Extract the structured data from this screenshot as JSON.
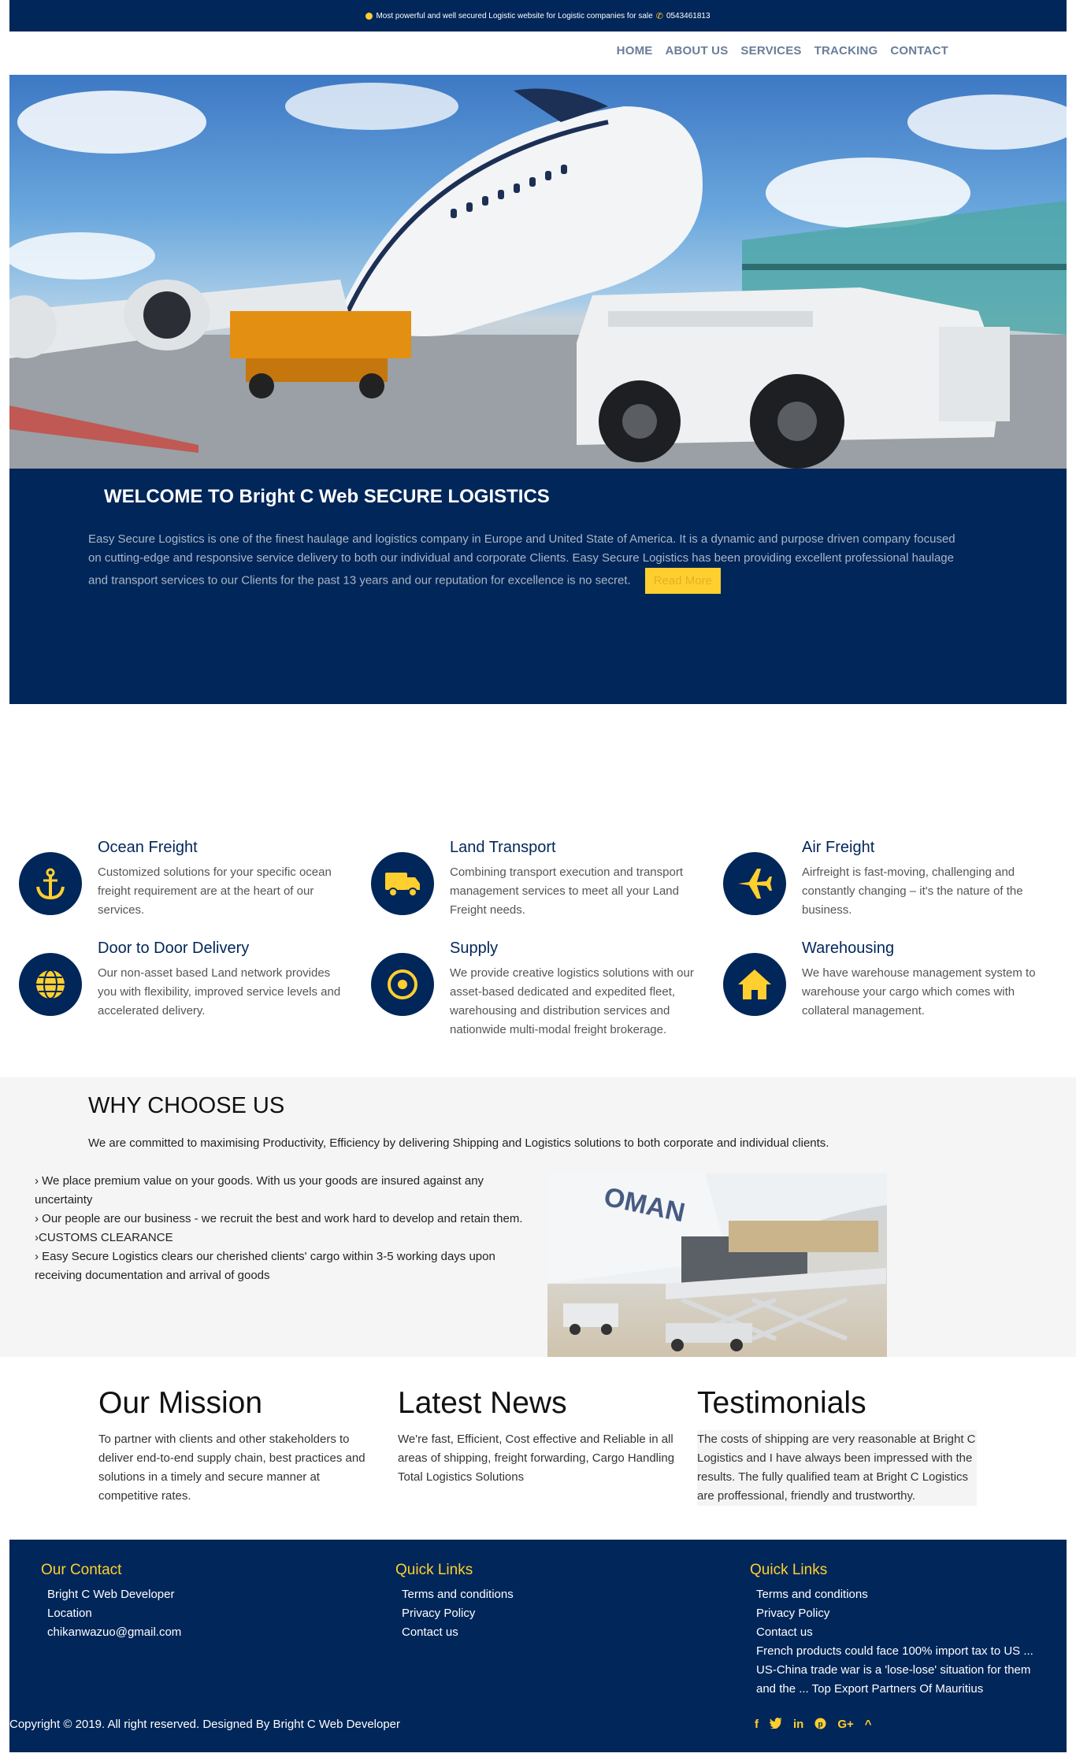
{
  "topbar": {
    "text": "Most powerful and well secured Logistic website for Logistic companies for sale",
    "phone": "0543461813"
  },
  "nav": {
    "items": [
      "HOME",
      "ABOUT US",
      "SERVICES",
      "TRACKING",
      "CONTACT"
    ]
  },
  "welcome": {
    "title": "WELCOME TO Bright C Web SECURE LOGISTICS",
    "body": "Easy Secure Logistics is one of the finest haulage and logistics company in Europe and United State of America. It is a dynamic and purpose driven company focused on cutting-edge and responsive service delivery to both our individual and corporate Clients. Easy Secure Logistics has been providing excellent professional haulage and transport services to our Clients for the past 13 years and our reputation for excellence is no secret.",
    "read_more": "Read More"
  },
  "services": [
    {
      "title": "Ocean Freight",
      "text": "Customized solutions for your specific ocean freight requirement are at the heart of our services.",
      "icon": "anchor-icon"
    },
    {
      "title": "Land Transport",
      "text": "Combining transport execution and transport management services to meet all your Land Freight needs.",
      "icon": "truck-icon"
    },
    {
      "title": "Air Freight",
      "text": "Airfreight is fast-moving, challenging and constantly changing – it's the nature of the business.",
      "icon": "plane-icon"
    },
    {
      "title": "Door to Door Delivery",
      "text": "Our non-asset based Land network provides you with flexibility, improved service levels and accelerated delivery.",
      "icon": "globe-icon"
    },
    {
      "title": "Supply",
      "text": "We provide creative logistics solutions with our asset-based dedicated and expedited fleet, warehousing and distribution services and nationwide multi-modal freight brokerage.",
      "icon": "target-icon"
    },
    {
      "title": "Warehousing",
      "text": "We have warehouse management system to warehouse your cargo which comes with collateral management.",
      "icon": "home-icon"
    }
  ],
  "why": {
    "title": "WHY CHOOSE US",
    "lead": "We are committed to maximising Productivity, Efficiency by delivering Shipping and Logistics solutions to both corporate and individual clients.",
    "items": [
      "We place premium value on your goods. With us your goods are insured against any uncertainty",
      "Our people are our business - we recruit the best and work hard to develop and retain them.",
      "CUSTOMS CLEARANCE",
      "Easy Secure Logistics clears our cherished clients' cargo within 3-5 working days upon receiving documentation and arrival of goods"
    ]
  },
  "columns": {
    "mission": {
      "title": "Our Mission",
      "text": "To partner with clients and other stakeholders to deliver end-to-end supply chain, best practices and solutions in a timely and secure manner at competitive rates."
    },
    "news": {
      "title": "Latest News",
      "text": "We're fast, Efficient, Cost effective and Reliable in all areas of shipping, freight forwarding, Cargo Handling Total Logistics Solutions"
    },
    "testimonials": {
      "title": "Testimonials",
      "text": "The costs of shipping are very reasonable at Bright C Logistics and I have always been impressed with the results. The fully qualified team at Bright C Logistics are proffessional, friendly and trustworthy."
    }
  },
  "footer": {
    "contact": {
      "title": "Our Contact",
      "name": "Bright C Web Developer",
      "location": "Location",
      "email": "chikanwazuo@gmail.com"
    },
    "links1": {
      "title": "Quick Links",
      "items": [
        "Terms and conditions",
        "Privacy Policy",
        "Contact us"
      ]
    },
    "links2": {
      "title": "Quick Links",
      "items": [
        "Terms and conditions",
        "Privacy Policy",
        "Contact us",
        "French products could face 100% import tax to US ...",
        "US-China trade war is a 'lose-lose' situation for them",
        "and the ... Top Export Partners Of Mauritius"
      ]
    },
    "copyright": "Copyright © 2019. All right reserved. Designed By Bright C Web Developer",
    "social": [
      "f",
      "twitter-icon",
      "in",
      "pinterest-icon",
      "G+",
      "^"
    ]
  },
  "colors": {
    "navy": "#012659",
    "yellow": "#ffcf2f",
    "nav_text": "#6a7d99"
  }
}
